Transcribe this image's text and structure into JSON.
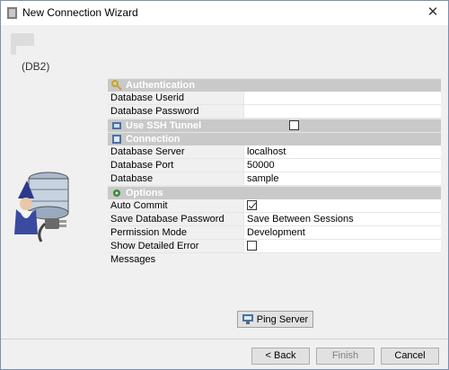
{
  "window": {
    "title": "New Connection Wizard",
    "close_label": "✕"
  },
  "header": {
    "db_type": "(DB2)"
  },
  "sections": {
    "authentication": {
      "label": "Authentication",
      "rows": [
        {
          "name": "Database Userid",
          "value": ""
        },
        {
          "name": "Database Password",
          "value": ""
        }
      ]
    },
    "ssh": {
      "label": "Use SSH Tunnel",
      "checked": false
    },
    "connection": {
      "label": "Connection",
      "rows": [
        {
          "name": "Database Server",
          "value": "localhost"
        },
        {
          "name": "Database Port",
          "value": "50000"
        },
        {
          "name": "Database",
          "value": "sample"
        }
      ]
    },
    "options": {
      "label": "Options",
      "auto_commit": {
        "name": "Auto Commit",
        "checked": true
      },
      "save_password": {
        "name": "Save Database Password",
        "value": "Save Between Sessions"
      },
      "permission": {
        "name": "Permission Mode",
        "value": "Development"
      },
      "detailed_errors": {
        "name": "Show Detailed Error Messages",
        "checked": false
      }
    }
  },
  "buttons": {
    "ping": "Ping Server",
    "back": "< Back",
    "finish": "Finish",
    "cancel": "Cancel"
  },
  "colors": {
    "section_bg": "#c9c9c9",
    "window_bg": "#f0f0f0"
  }
}
